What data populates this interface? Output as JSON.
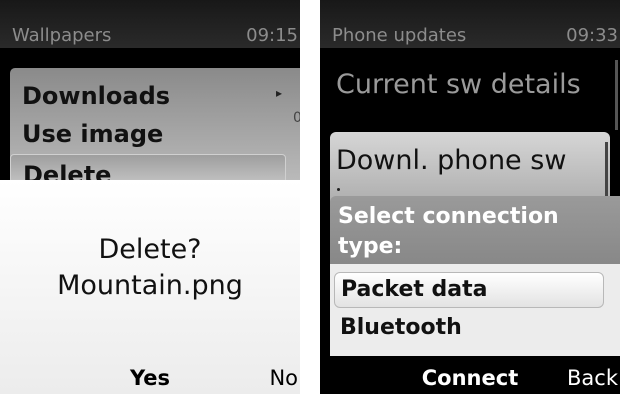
{
  "left_screen": {
    "status": {
      "title": "Wallpapers",
      "time": "09:15"
    },
    "menu": {
      "items": [
        {
          "label": "Downloads",
          "has_submenu": true
        },
        {
          "label": "Use image"
        },
        {
          "label": "Delete",
          "selected": true
        }
      ]
    },
    "background_scrollbar_glyph": "0",
    "dialog": {
      "question": "Delete?",
      "filename": "Mountain.png",
      "softkeys": {
        "center": "Yes",
        "right": "No"
      }
    }
  },
  "right_screen": {
    "status": {
      "title": "Phone updates",
      "time": "09:33"
    },
    "heading": "Current sw details",
    "card_label": "Downl. phone sw",
    "dialog": {
      "prompt": "Select connection type:",
      "options": [
        {
          "label": "Packet data",
          "selected": true
        },
        {
          "label": "Bluetooth"
        }
      ],
      "softkeys": {
        "center": "Connect",
        "right": "Back"
      }
    }
  }
}
